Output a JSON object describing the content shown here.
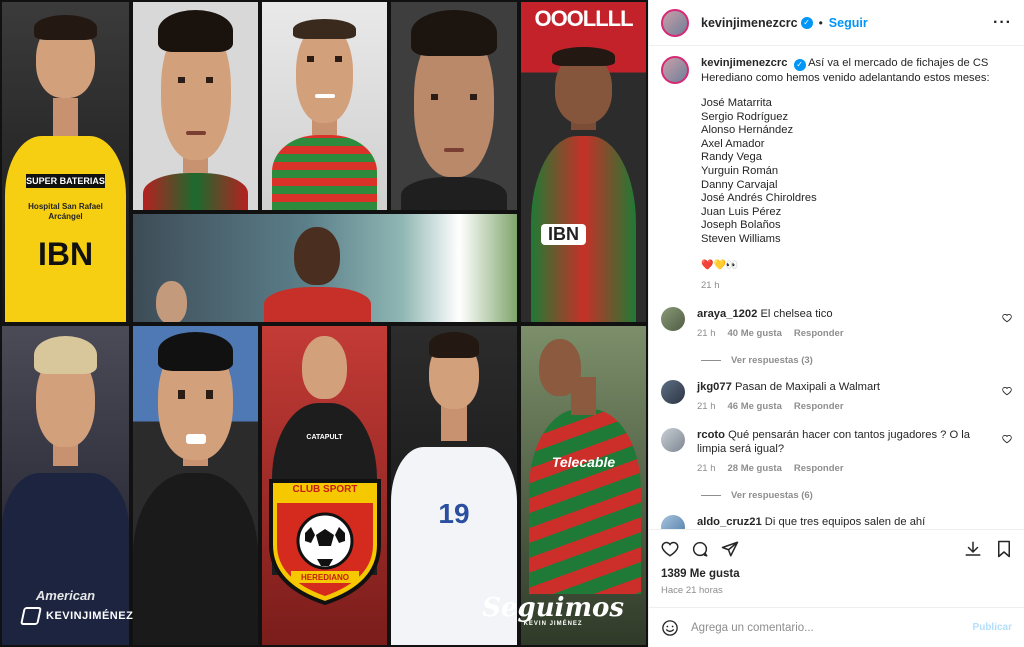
{
  "post": {
    "username": "kevinjimenezcrc",
    "follow_label": "Seguir",
    "caption_text": "Así va el mercado de fichajes de CS Herediano como hemos venido adelantando estos meses:",
    "players": [
      "José Matarrita",
      "Sergio Rodríguez",
      "Alonso Hernández",
      "Axel Amador",
      "Randy Vega",
      "Yurguin Román",
      "Danny Carvajal",
      "José Andrés Chiroldres",
      "Juan Luis Pérez",
      "Joseph Bolaños",
      "Steven Williams"
    ],
    "emojis": "❤️💛👀",
    "caption_time": "21 h",
    "likes": "1389 Me gusta",
    "posted_ago": "Hace 21 horas"
  },
  "comments": [
    {
      "user": "araya_1202",
      "text": "El chelsea tico",
      "time": "21 h",
      "likes": "40 Me gusta",
      "reply": "Responder",
      "replies": "Ver respuestas (3)"
    },
    {
      "user": "jkg077",
      "text": "Pasan de Maxipali a Walmart",
      "time": "21 h",
      "likes": "46 Me gusta",
      "reply": "Responder",
      "replies": ""
    },
    {
      "user": "rcoto",
      "text": "Qué pensarán hacer con tantos jugadores ? O la limpia será igual?",
      "time": "21 h",
      "likes": "28 Me gusta",
      "reply": "Responder",
      "replies": "Ver respuestas (6)"
    },
    {
      "user": "aldo_cruz21",
      "text": "Di que tres equipos salen de ahí",
      "time": "",
      "likes": "",
      "reply": "",
      "replies": ""
    }
  ],
  "add_comment": {
    "placeholder": "Agrega un comentario...",
    "publish_label": "Publicar"
  },
  "collage": {
    "shirt_texts": [
      "SUPER BATERIAS",
      "Hospital San Rafael Arcángel",
      "IBN",
      "Telecable",
      "IBN",
      "CATAPULT",
      "19"
    ],
    "top_banner": "OOOLLLL",
    "crest_top": "CLUB SPORT",
    "crest_bottom": "HEREDIANO",
    "watermark": "KEVINJIMÉNEZ",
    "seguimos": "Seguimos",
    "seguimos_sub": "KEVIN JIMÉNEZ",
    "sponsor_misc": "American"
  },
  "colors": {
    "accent_blue": "#0095f6",
    "herediano_red": "#d52b1e",
    "herediano_yellow": "#f6c800"
  }
}
